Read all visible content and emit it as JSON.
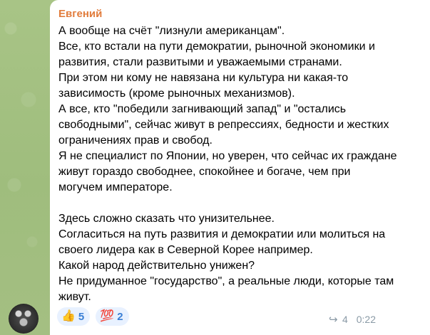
{
  "message": {
    "sender": "Евгений",
    "lines": [
      "А вообще на счёт \"лизнули американцам\".",
      "Все, кто встали на пути демократии, рыночной экономики и",
      "развития, стали развитыми и уважаемыми странами.",
      "При этом ни кому не навязана ни культура ни какая-то",
      "зависимость (кроме рыночных механизмов).",
      "А все, кто \"победили загнивающий запад\" и \"остались",
      "свободными\", сейчас живут в репрессиях, бедности и жестких",
      "ограничениях прав и свобод.",
      "Я не специалист по Японии, но уверен, что сейчас их граждане",
      "живут гораздо свободнее, спокойнее и богаче, чем при",
      "могучем императоре.",
      "",
      "Здесь сложно сказать что унизительнее.",
      "Согласиться на путь развития и демократии или молиться на",
      "своего лидера как в Северной Корее например.",
      "Какой народ действительно унижен?",
      "Не придуманное \"государство\", а реальные люди, которые там",
      "живут."
    ],
    "reactions": [
      {
        "emoji": "👍",
        "count": "5"
      },
      {
        "emoji": "💯",
        "count": "2"
      }
    ],
    "replies": "4",
    "time": "0:22"
  },
  "colors": {
    "sender": "#e17c3c",
    "reaction_text": "#3a7fd5",
    "reaction_bg": "#e8f1ff",
    "background": "#a6c183"
  },
  "icons": {
    "reply": "reply-arrow-icon",
    "avatar": "group-photo-avatar"
  }
}
